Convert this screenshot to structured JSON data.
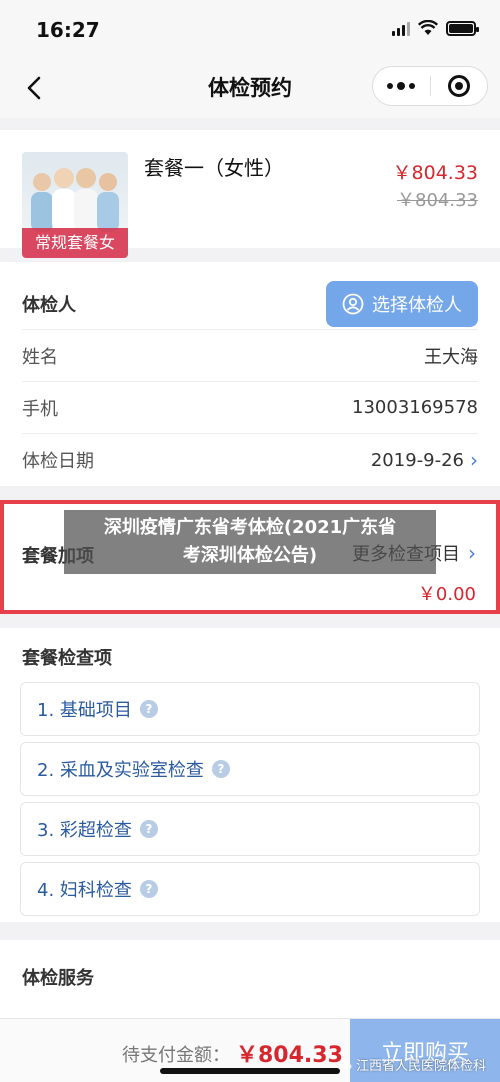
{
  "status": {
    "time": "16:27"
  },
  "nav": {
    "title": "体检预约"
  },
  "package": {
    "name": "套餐一（女性）",
    "tag": "常规套餐女",
    "price": "￥804.33",
    "original_price": "￥804.33"
  },
  "person": {
    "section_title": "体检人",
    "select_button": "选择体检人",
    "name_label": "姓名",
    "name_value": "王大海",
    "phone_label": "手机",
    "phone_value": "13003169578",
    "date_label": "体检日期",
    "date_value": "2019-9-26"
  },
  "addon": {
    "label": "套餐加项",
    "more": "更多检查项目",
    "price": "￥0.00"
  },
  "overlay": {
    "line1": "深圳疫情广东省考体检(2021广东省",
    "line2": "考深圳体检公告)"
  },
  "check_items": {
    "title": "套餐检查项",
    "items": [
      "1. 基础项目",
      "2. 采血及实验室检查",
      "3. 彩超检查",
      "4. 妇科检查"
    ]
  },
  "service": {
    "title": "体检服务"
  },
  "bottom": {
    "pay_label": "待支付金额：",
    "pay_amount": "￥804.33",
    "buy_button": "立即购买",
    "watermark": "江西省人民医院体检科"
  },
  "colors": {
    "accent_red": "#d8262e",
    "accent_blue": "#74a6ea",
    "highlight_border": "#e8404b"
  }
}
